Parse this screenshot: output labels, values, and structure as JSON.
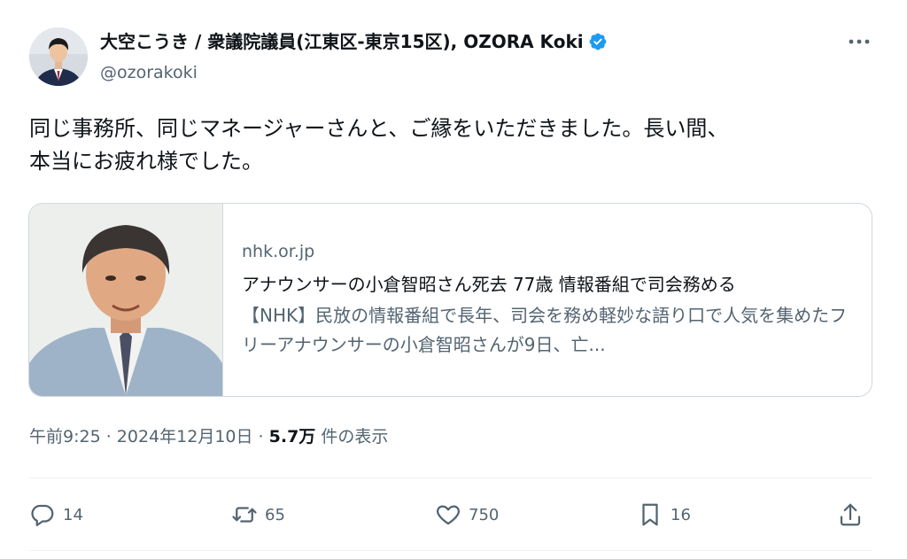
{
  "author": {
    "display_name": "大空こうき / 衆議院議員(江東区-東京15区), OZORA Koki",
    "handle": "@ozorakoki",
    "verified": true,
    "verified_color": "#1d9bf0"
  },
  "more_icon": "ellipsis-icon",
  "tweet": {
    "text": "同じ事務所、同じマネージャーさんと、ご縁をいただきました。長い間、\n本当にお疲れ様でした。"
  },
  "card": {
    "domain": "nhk.or.jp",
    "title": "アナウンサーの小倉智昭さん死去 77歳 情報番組で司会務める",
    "description": "【NHK】民放の情報番組で長年、司会を務め軽妙な語り口で人気を集めたフリーアナウンサーの小倉智昭さんが9日、亡..."
  },
  "meta": {
    "time": "午前9:25",
    "separator": " · ",
    "date": "2024年12月10日",
    "views_count": "5.7万",
    "views_label": " 件の表示"
  },
  "actions": {
    "reply_count": "14",
    "retweet_count": "65",
    "like_count": "750",
    "bookmark_count": "16"
  }
}
